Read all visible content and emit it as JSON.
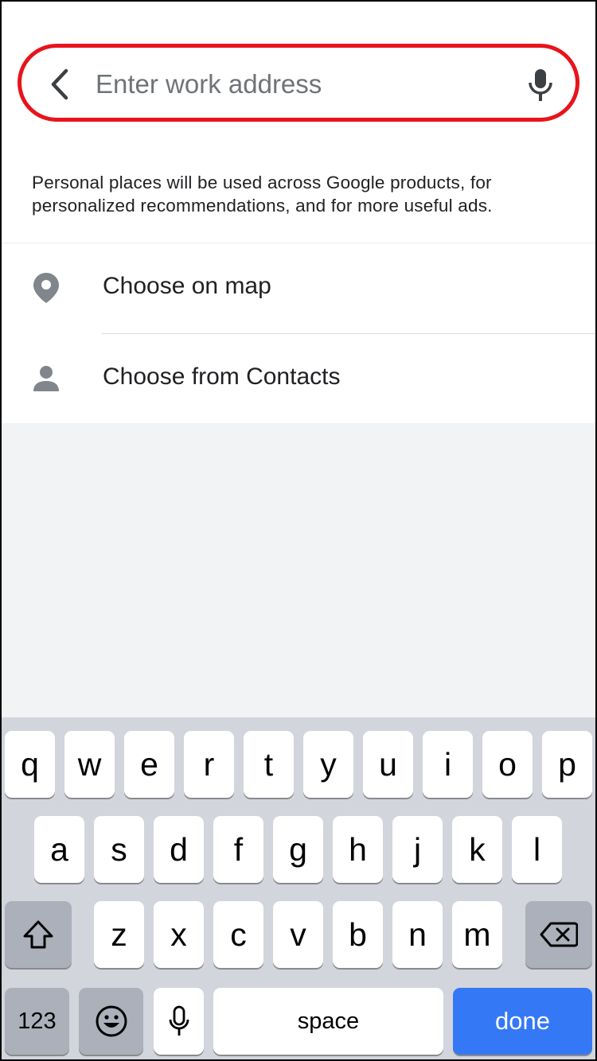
{
  "search": {
    "placeholder": "Enter work address",
    "value": "",
    "back_icon": "chevron-left-icon",
    "mic_icon": "microphone-icon",
    "highlight_color": "#e8141b"
  },
  "disclaimer": {
    "line1": "Personal places will be used across Google products, for",
    "line2": "personalized recommendations, and for more useful ads."
  },
  "options": [
    {
      "label": "Choose on map",
      "icon": "map-pin-icon"
    },
    {
      "label": "Choose from Contacts",
      "icon": "person-icon"
    }
  ],
  "keyboard": {
    "row1": [
      "q",
      "w",
      "e",
      "r",
      "t",
      "y",
      "u",
      "i",
      "o",
      "p"
    ],
    "row2": [
      "a",
      "s",
      "d",
      "f",
      "g",
      "h",
      "j",
      "k",
      "l"
    ],
    "row3": [
      "z",
      "x",
      "c",
      "v",
      "b",
      "n",
      "m"
    ],
    "shift_icon": "shift-icon",
    "backspace_icon": "backspace-icon",
    "numbers_label": "123",
    "emoji_icon": "emoji-icon",
    "dictation_icon": "microphone-icon",
    "space_label": "space",
    "done_label": "done",
    "done_color": "#3478f6"
  }
}
